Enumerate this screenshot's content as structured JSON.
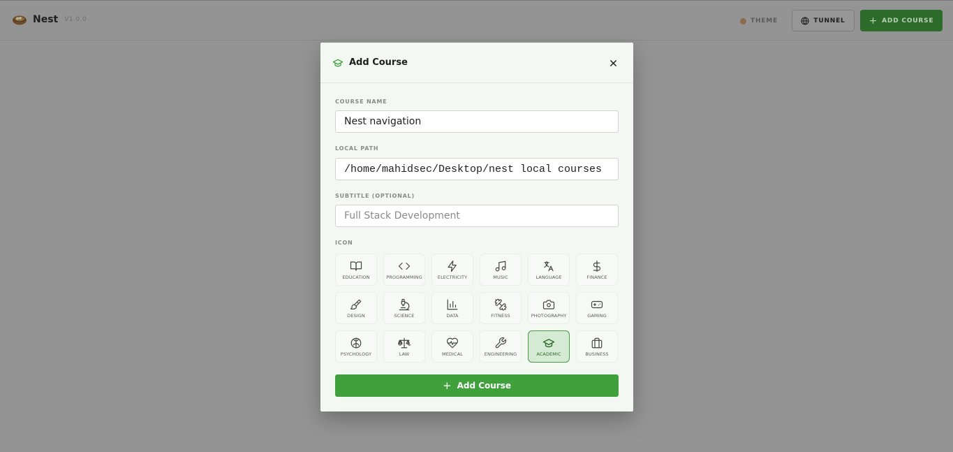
{
  "app": {
    "name": "Nest",
    "version": "V1.0.0"
  },
  "header": {
    "theme_label": "THEME",
    "tunnel_label": "TUNNEL",
    "add_course_label": "ADD COURSE"
  },
  "modal": {
    "title": "Add Course",
    "course_name": {
      "label": "COURSE NAME",
      "value": "Nest navigation"
    },
    "local_path": {
      "label": "LOCAL PATH",
      "value": "/home/mahidsec/Desktop/nest local courses"
    },
    "subtitle": {
      "label": "SUBTITLE (OPTIONAL)",
      "placeholder": "Full Stack Development"
    },
    "icon_section_label": "ICON",
    "icons": [
      {
        "label": "EDUCATION",
        "icon": "book-open-icon"
      },
      {
        "label": "PROGRAMMING",
        "icon": "code-icon"
      },
      {
        "label": "ELECTRICITY",
        "icon": "zap-icon"
      },
      {
        "label": "MUSIC",
        "icon": "music-icon"
      },
      {
        "label": "LANGUAGE",
        "icon": "languages-icon"
      },
      {
        "label": "FINANCE",
        "icon": "dollar-icon"
      },
      {
        "label": "DESIGN",
        "icon": "paintbrush-icon"
      },
      {
        "label": "SCIENCE",
        "icon": "microscope-icon"
      },
      {
        "label": "DATA",
        "icon": "bar-chart-icon"
      },
      {
        "label": "FITNESS",
        "icon": "dumbbell-icon"
      },
      {
        "label": "PHOTOGRAPHY",
        "icon": "camera-icon"
      },
      {
        "label": "GAMING",
        "icon": "gamepad-icon"
      },
      {
        "label": "PSYCHOLOGY",
        "icon": "brain-icon"
      },
      {
        "label": "LAW",
        "icon": "scale-icon"
      },
      {
        "label": "MEDICAL",
        "icon": "heart-pulse-icon"
      },
      {
        "label": "ENGINEERING",
        "icon": "wrench-icon"
      },
      {
        "label": "ACADEMIC",
        "icon": "graduation-cap-icon",
        "selected": true
      },
      {
        "label": "BUSINESS",
        "icon": "briefcase-icon"
      }
    ],
    "submit_label": "Add Course"
  },
  "colors": {
    "accent": "#3fa03c",
    "accent_dark": "#2d6b2b",
    "selected_bg": "#d5ead3",
    "overlay": "#949494"
  }
}
